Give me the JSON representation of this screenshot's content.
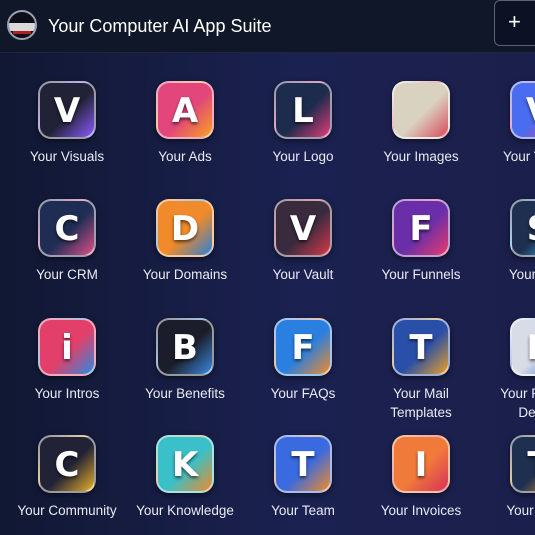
{
  "header": {
    "title": "Your Computer AI App Suite",
    "add_glyph": "+",
    "logo_icon": "brand-logo-icon"
  },
  "apps": [
    {
      "label": "Your Visuals",
      "glyph": "V",
      "color": "#222236",
      "accent": "#8a5cff",
      "icon": "visuals-icon"
    },
    {
      "label": "Your Ads",
      "glyph": "A",
      "color": "#e2467a",
      "accent": "#f7a320",
      "icon": "ads-icon"
    },
    {
      "label": "Your Logo",
      "glyph": "L",
      "color": "#1d2b4d",
      "accent": "#e23d7a",
      "icon": "logo-icon"
    },
    {
      "label": "Your Images",
      "glyph": "",
      "color": "#d9d2c0",
      "accent": "#d84a5a",
      "icon": "images-icon"
    },
    {
      "label": "Your Videos",
      "glyph": "V",
      "color": "#4a6cf0",
      "accent": "#e0408a",
      "icon": "videos-icon"
    },
    {
      "label": "Your CRM",
      "glyph": "C",
      "color": "#1f2d55",
      "accent": "#e0508a",
      "icon": "crm-icon"
    },
    {
      "label": "Your Domains",
      "glyph": "D",
      "color": "#f08a2a",
      "accent": "#2a7fd6",
      "icon": "domains-icon"
    },
    {
      "label": "Your Vault",
      "glyph": "V",
      "color": "#3a2a3e",
      "accent": "#d6384a",
      "icon": "vault-icon"
    },
    {
      "label": "Your Funnels",
      "glyph": "F",
      "color": "#6a2fa8",
      "accent": "#e83a6a",
      "icon": "funnels-icon"
    },
    {
      "label": "Your SMS",
      "glyph": "S",
      "color": "#1e2f4f",
      "accent": "#3cc0ff",
      "icon": "sms-icon"
    },
    {
      "label": "Your Intros",
      "glyph": "i",
      "color": "#e2406a",
      "accent": "#2a8ae0",
      "icon": "intros-icon"
    },
    {
      "label": "Your Benefits",
      "glyph": "B",
      "color": "#1b1e2a",
      "accent": "#3a8ae0",
      "icon": "benefits-icon"
    },
    {
      "label": "Your FAQs",
      "glyph": "F",
      "color": "#2a7fe0",
      "accent": "#f08a2a",
      "icon": "faqs-icon"
    },
    {
      "label": "Your Mail Templates",
      "glyph": "T",
      "color": "#2a4fa8",
      "accent": "#e8a02a",
      "icon": "mail-templates-icon"
    },
    {
      "label": "Your Product Details",
      "glyph": "P",
      "color": "#d8dce6",
      "accent": "#3a6fd6",
      "icon": "product-details-icon"
    },
    {
      "label": "Your Community",
      "glyph": "C",
      "color": "#222236",
      "accent": "#e8b02a",
      "icon": "community-icon"
    },
    {
      "label": "Your Knowledge",
      "glyph": "K",
      "color": "#3ac0c8",
      "accent": "#f08a2a",
      "icon": "knowledge-icon"
    },
    {
      "label": "Your Team",
      "glyph": "T",
      "color": "#3a6ae0",
      "accent": "#f08a2a",
      "icon": "team-icon"
    },
    {
      "label": "Your Invoices",
      "glyph": "I",
      "color": "#f07a3a",
      "accent": "#d8305a",
      "icon": "invoices-icon"
    },
    {
      "label": "Your Tasks",
      "glyph": "T",
      "color": "#1e2f4f",
      "accent": "#f0a02a",
      "icon": "tasks-icon"
    }
  ]
}
